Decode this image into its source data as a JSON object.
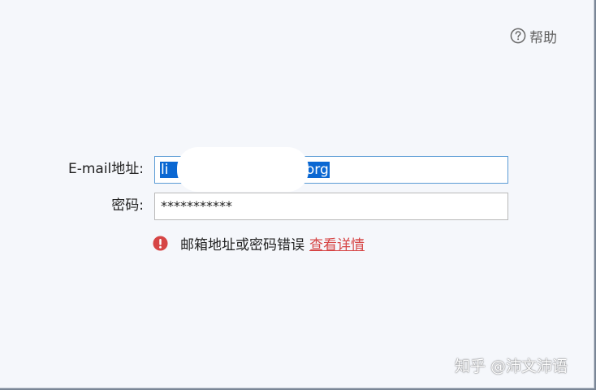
{
  "help": {
    "icon": "question-circle-icon",
    "label": "帮助"
  },
  "form": {
    "email_label": "E-mail地址:",
    "email_value_prefix": "li",
    "email_value_suffix": ".org",
    "password_label": "密码:",
    "password_value": "***********"
  },
  "error": {
    "icon": "exclamation-circle-icon",
    "message": "邮箱地址或密码错误",
    "link_label": "查看详情",
    "color": "#d64545"
  },
  "watermark": {
    "text": "知乎 @沛文沛语"
  },
  "colors": {
    "selection": "#0a67d2",
    "focus_border": "#5a9bd5",
    "background": "#f5f7fb"
  }
}
